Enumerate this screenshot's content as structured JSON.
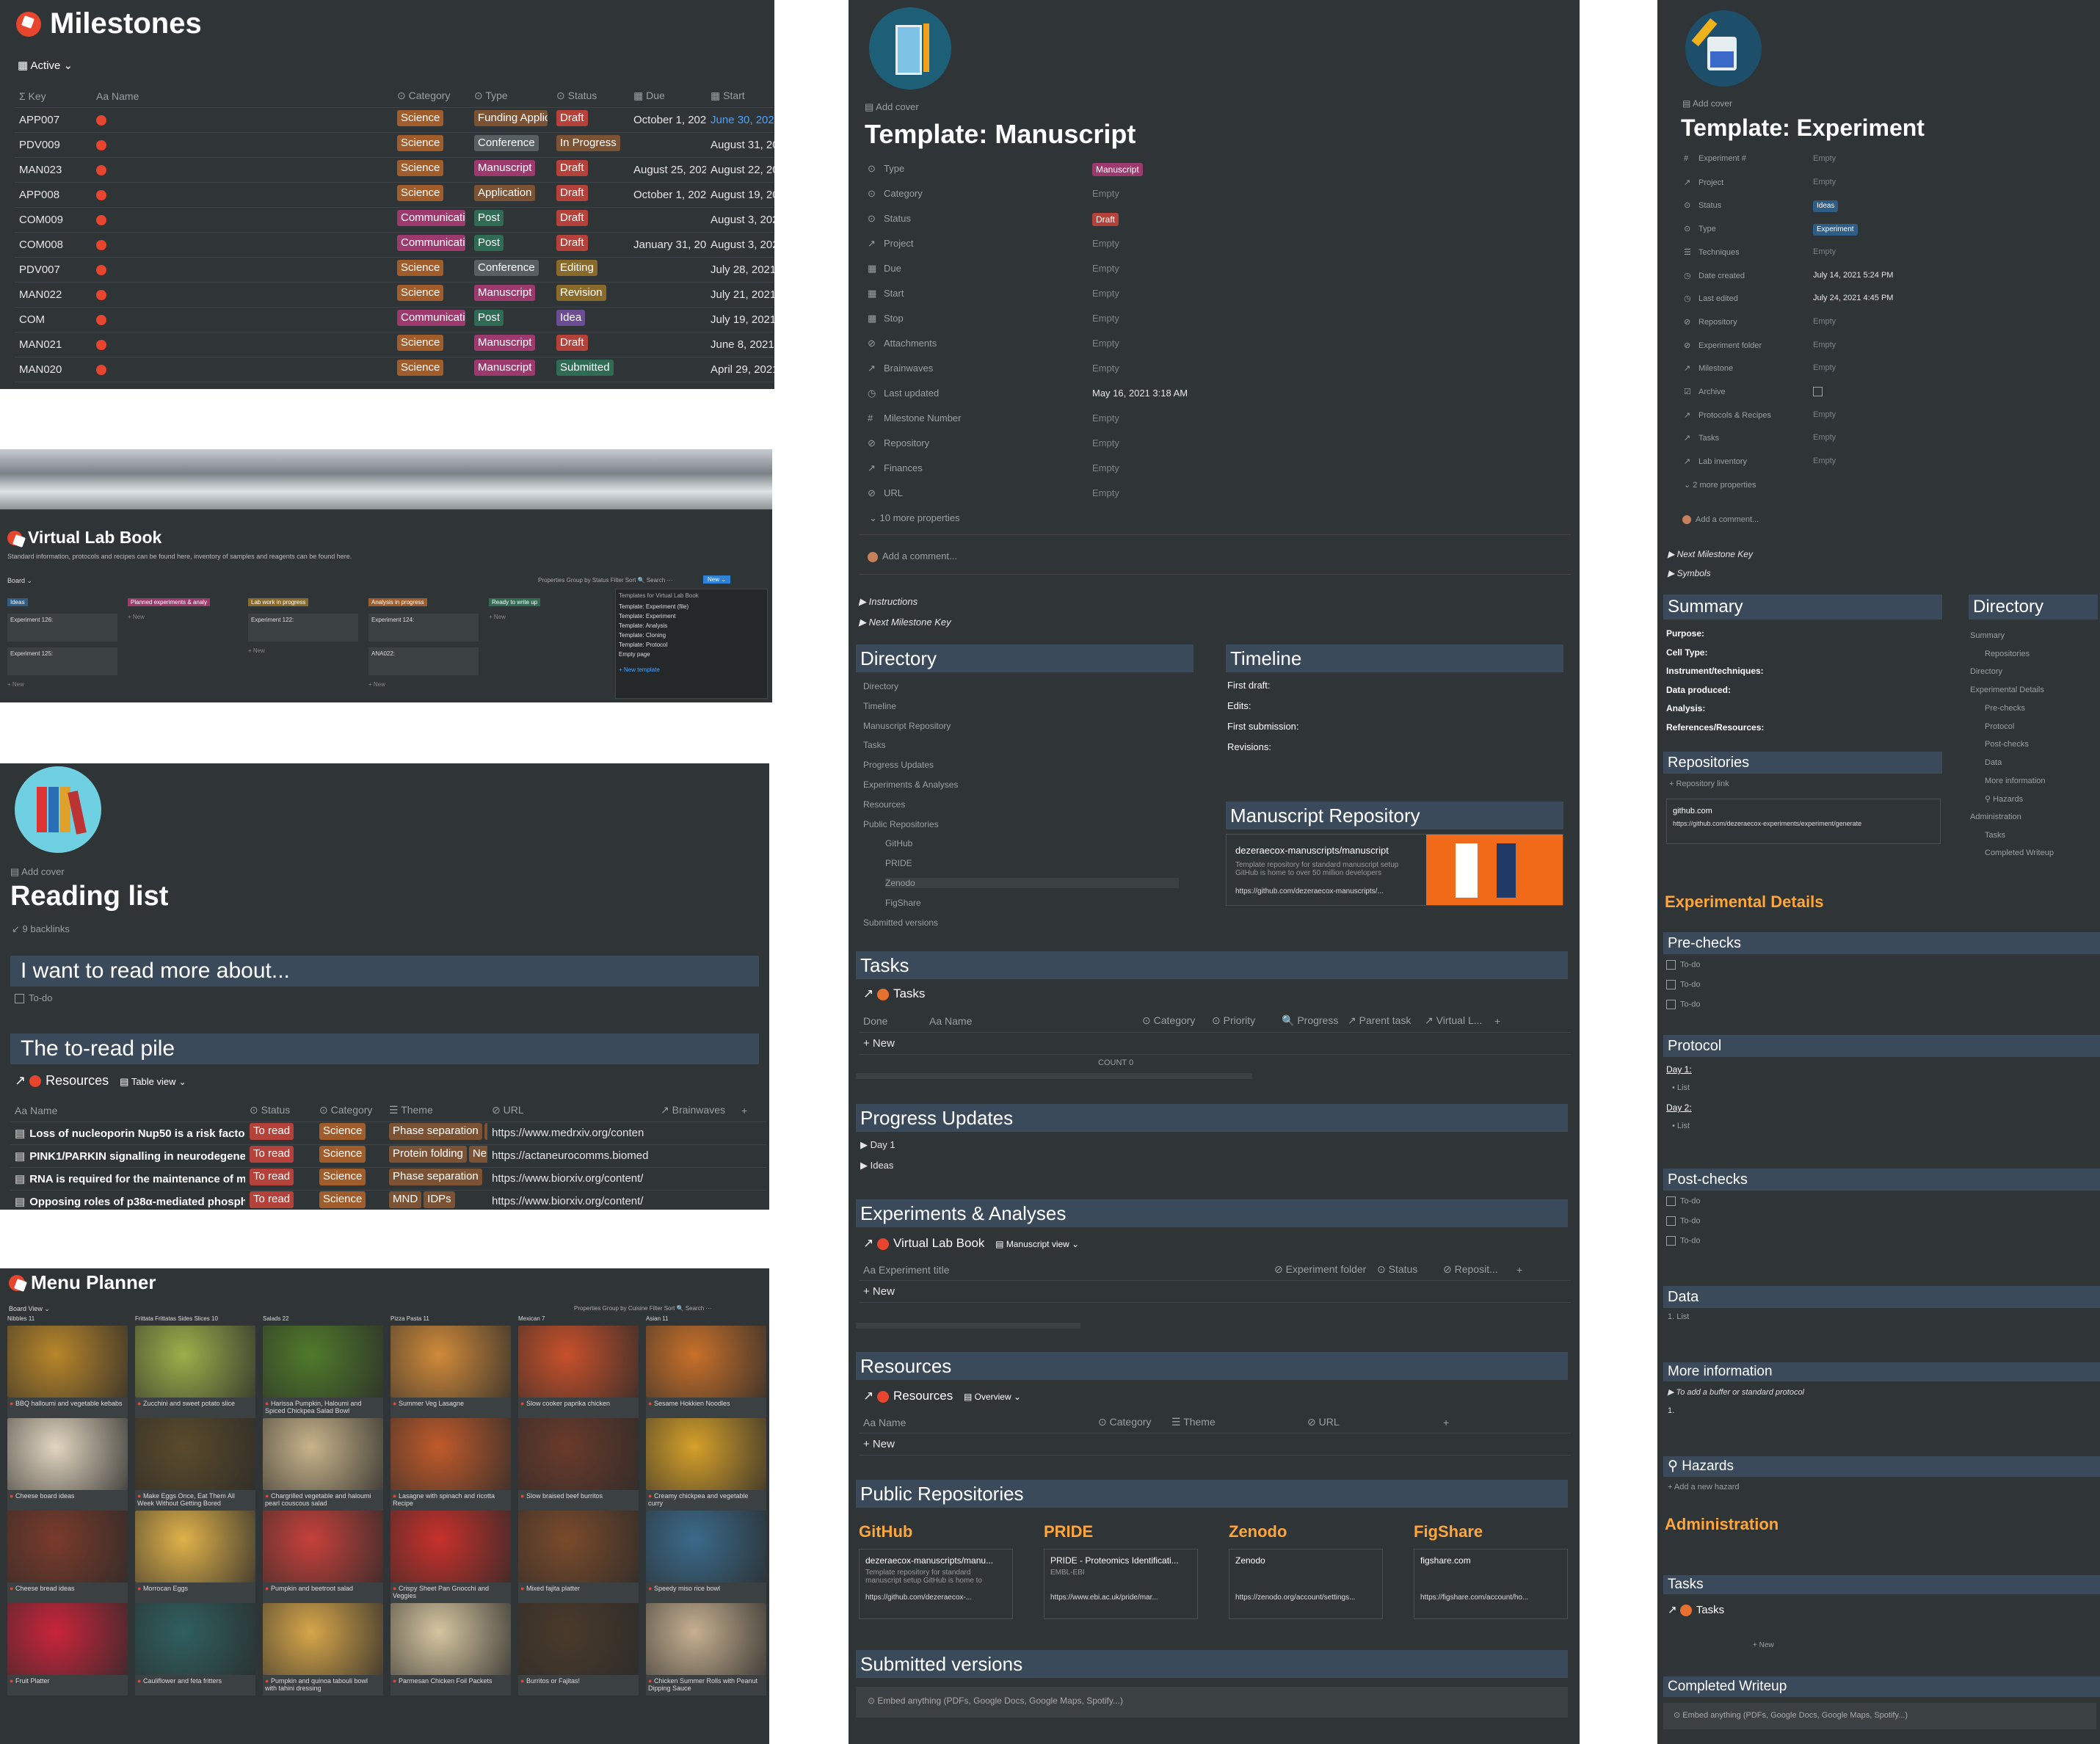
{
  "milestones": {
    "title": "Milestones",
    "view": "Active ⌄",
    "headers": [
      "Σ Key",
      "Aa Name",
      "⊙ Category",
      "⊙ Type",
      "⊙ Status",
      "▦ Due",
      "▦ Start"
    ],
    "rows": [
      {
        "key": "APP007",
        "cat": "Science",
        "type": "Funding Applic",
        "status": "Draft",
        "due": "October 1, 202",
        "start": "June 30, 2022"
      },
      {
        "key": "PDV009",
        "cat": "Science",
        "type": "Conference",
        "status": "In Progress",
        "due": "",
        "start": "August 31, 202"
      },
      {
        "key": "MAN023",
        "cat": "Science",
        "type": "Manuscript",
        "status": "Draft",
        "due": "August 25, 202",
        "start": "August 22, 202"
      },
      {
        "key": "APP008",
        "cat": "Science",
        "type": "Application",
        "status": "Draft",
        "due": "October 1, 202",
        "start": "August 19, 202"
      },
      {
        "key": "COM009",
        "cat": "Communicati",
        "type": "Post",
        "status": "Draft",
        "due": "",
        "start": "August 3, 2021"
      },
      {
        "key": "COM008",
        "cat": "Communicati",
        "type": "Post",
        "status": "Draft",
        "due": "January 31, 202",
        "start": "August 3, 2021"
      },
      {
        "key": "PDV007",
        "cat": "Science",
        "type": "Conference",
        "status": "Editing",
        "due": "",
        "start": "July 28, 2021"
      },
      {
        "key": "MAN022",
        "cat": "Science",
        "type": "Manuscript",
        "status": "Revision",
        "due": "",
        "start": "July 21, 2021"
      },
      {
        "key": "COM",
        "cat": "Communicati",
        "type": "Post",
        "status": "Idea",
        "due": "",
        "start": "July 19, 2021"
      },
      {
        "key": "MAN021",
        "cat": "Science",
        "type": "Manuscript",
        "status": "Draft",
        "due": "",
        "start": "June 8, 2021"
      },
      {
        "key": "MAN020",
        "cat": "Science",
        "type": "Manuscript",
        "status": "Submitted",
        "due": "",
        "start": "April 29, 2021"
      }
    ]
  },
  "labbook": {
    "title": "Virtual Lab Book",
    "desc": "Standard information, protocols and recipes can be found here, inventory of samples and reagents can be found here.",
    "view": "Board ⌄",
    "toolbar": "Properties   Group by Status   Filter   Sort   🔍 Search   ···",
    "new_label": "New ⌄",
    "columns": [
      "Ideas",
      "Planned experiments & analy",
      "Lab work in progress",
      "Analysis in progress",
      "Ready to write up"
    ],
    "cards": [
      "Experiment 126:",
      "Experiment 125:",
      "Experiment 122:",
      "Experiment 124:",
      "ANA022:"
    ],
    "new": "+ New",
    "templates_title": "Templates for Virtual Lab Book",
    "templates": [
      "Template: Experiment (file)",
      "Template: Experiment",
      "Template: Analysis",
      "Template: Cloning",
      "Template: Protocol",
      "Empty page",
      "+ New template"
    ]
  },
  "reading": {
    "add_cover": "▤ Add cover",
    "title": "Reading list",
    "backlinks": "↙ 9 backlinks",
    "h1": "I want to read more about...",
    "todo": "To-do",
    "h2": "The to-read pile",
    "db_title": "Resources",
    "db_view": "▤ Table view ⌄",
    "headers": [
      "Aa Name",
      "⊙ Status",
      "⊙ Category",
      "☰ Theme",
      "⊘ URL",
      "↗ Brainwaves",
      "+"
    ],
    "rows": [
      {
        "name": "Loss of nucleoporin Nup50 is a risk factor for a",
        "status": "To read",
        "cat": "Science",
        "theme": "Phase separation",
        "theme2": "M",
        "url": "https://www.medrxiv.org/conten"
      },
      {
        "name": "PINK1/PARKIN signalling in neurodegeneration",
        "status": "To read",
        "cat": "Science",
        "theme": "Protein folding",
        "theme2": "Neu",
        "url": "https://actaneurocomms.biomed"
      },
      {
        "name": "RNA is required for the maintenance of multipl",
        "status": "To read",
        "cat": "Science",
        "theme": "Phase separation",
        "theme2": "",
        "url": "https://www.biorxiv.org/content/"
      },
      {
        "name": "Opposing roles of p38α-mediated phosphoryla",
        "status": "To read",
        "cat": "Science",
        "theme": "MND",
        "theme2": "IDPs",
        "url": "https://www.biorxiv.org/content/"
      }
    ]
  },
  "menu": {
    "title": "Menu Planner",
    "view": "Board View ⌄",
    "toolbar": "Properties   Group by Cuisine   Filter   Sort   🔍 Search   ···",
    "columns": [
      "Nibbles 11",
      "Frittata Frittatas Sides Slices 10",
      "Salads 22",
      "Pizza Pasta 11",
      "Mexican 7",
      "Asian 11"
    ],
    "recipes": [
      [
        "BBQ halloumi and vegetable kebabs",
        "Cheese board ideas",
        "Cheese bread ideas",
        "Fruit Platter"
      ],
      [
        "Zucchini and sweet potato slice",
        "Make Eggs Once, Eat Them All Week Without Getting Bored",
        "Morrocan Eggs",
        "Cauliflower and feta fritters"
      ],
      [
        "Harissa Pumpkin, Haloumi and Spiced Chickpea Salad Bowl",
        "Chargrilled vegetable and haloumi pearl couscous salad",
        "Pumpkin and beetroot salad",
        "Pumpkin and quinoa tabouli bowl with tahini dressing"
      ],
      [
        "Summer Veg Lasagne",
        "Lasagne with spinach and ricotta Recipe",
        "Crispy Sheet Pan Gnocchi and Veggies",
        "Parmesan Chicken Foil Packets"
      ],
      [
        "Slow cooker paprika chicken",
        "Slow braised beef burritos",
        "Mixed fajita platter",
        "Burritos or Fajitas!"
      ],
      [
        "Sesame Hokkien Noodles",
        "Creamy chickpea and vegetable curry",
        "Speedy miso rice bowl",
        "Chicken Summer Rolls with Peanut Dipping Sauce"
      ]
    ]
  },
  "manuscript": {
    "add_cover": "▤ Add cover",
    "title": "Template: Manuscript",
    "props": [
      {
        "k": "Type",
        "v": "Manuscript"
      },
      {
        "k": "Category",
        "v": "Empty"
      },
      {
        "k": "Status",
        "v": "Draft"
      },
      {
        "k": "Project",
        "v": "Empty"
      },
      {
        "k": "Due",
        "v": "Empty"
      },
      {
        "k": "Start",
        "v": "Empty"
      },
      {
        "k": "Stop",
        "v": "Empty"
      },
      {
        "k": "Attachments",
        "v": "Empty"
      },
      {
        "k": "Brainwaves",
        "v": "Empty"
      },
      {
        "k": "Last updated",
        "v": "May 16, 2021 3:18 AM"
      },
      {
        "k": "Milestone Number",
        "v": "Empty"
      },
      {
        "k": "Repository",
        "v": "Empty"
      },
      {
        "k": "Finances",
        "v": "Empty"
      },
      {
        "k": "URL",
        "v": "Empty"
      }
    ],
    "more_props": "⌄ 10 more properties",
    "comment": "Add a comment...",
    "toggles": [
      "Instructions",
      "Next Milestone Key"
    ],
    "directory_title": "Directory",
    "directory": [
      "Directory",
      "Timeline",
      "Manuscript Repository",
      "Tasks",
      "Progress Updates",
      "Experiments & Analyses",
      "Resources",
      "Public Repositories",
      "GitHub",
      "PRIDE",
      "Zenodo",
      "FigShare",
      "Submitted versions"
    ],
    "timeline_title": "Timeline",
    "timeline": [
      "First draft:",
      "Edits:",
      "First submission:",
      "Revisions:"
    ],
    "repo_title": "Manuscript Repository",
    "repo_name": "dezeraecox-manuscripts/manuscript",
    "repo_desc": "Template repository for standard manuscript setup GitHub is home to over 50 million developers",
    "repo_url": "https://github.com/dezeraecox-manuscripts/...",
    "tasks_title": "Tasks",
    "tasks_db": "Tasks",
    "tasks_headers": [
      "Done",
      "Aa Name",
      "⊙ Category",
      "⊙ Priority",
      "🔍 Progress",
      "↗ Parent task",
      "↗ Virtual L...",
      "+"
    ],
    "new": "+ New",
    "count": "COUNT 0",
    "progress_title": "Progress Updates",
    "progress_items": [
      "Day 1",
      "Ideas"
    ],
    "exp_title": "Experiments & Analyses",
    "exp_db": "Virtual Lab Book",
    "exp_view": "▤ Manuscript view ⌄",
    "exp_headers": [
      "Aa Experiment title",
      "⊘ Experiment folder",
      "⊙ Status",
      "⊘ Reposit...",
      "+"
    ],
    "res_title": "Resources",
    "res_db": "Resources",
    "res_view": "▤ Overview ⌄",
    "res_headers": [
      "Aa Name",
      "⊙ Category",
      "☰ Theme",
      "⊘ URL",
      "+"
    ],
    "pub_title": "Public Repositories",
    "pub": [
      {
        "h": "GitHub",
        "n": "dezeraecox-manuscripts/manu...",
        "d": "Template repository for standard manuscript setup GitHub is home to",
        "u": "https://github.com/dezeraecox-..."
      },
      {
        "h": "PRIDE",
        "n": "PRIDE - Proteomics Identificati...",
        "d": "EMBL-EBI",
        "u": "https://www.ebi.ac.uk/pride/mar..."
      },
      {
        "h": "Zenodo",
        "n": "Zenodo",
        "d": "",
        "u": "https://zenodo.org/account/settings..."
      },
      {
        "h": "FigShare",
        "n": "figshare.com",
        "d": "",
        "u": "https://figshare.com/account/ho..."
      }
    ],
    "sub_title": "Submitted versions",
    "embed": "Embed anything (PDFs, Google Docs, Google Maps, Spotify...)"
  },
  "experiment": {
    "add_cover": "▤ Add cover",
    "title": "Template: Experiment",
    "props": [
      {
        "k": "Experiment #",
        "v": "Empty"
      },
      {
        "k": "Project",
        "v": "Empty"
      },
      {
        "k": "Status",
        "v": "Ideas"
      },
      {
        "k": "Type",
        "v": "Experiment"
      },
      {
        "k": "Techniques",
        "v": "Empty"
      },
      {
        "k": "Date created",
        "v": "July 14, 2021 5:24 PM"
      },
      {
        "k": "Last edited",
        "v": "July 24, 2021 4:45 PM"
      },
      {
        "k": "Repository",
        "v": "Empty"
      },
      {
        "k": "Experiment folder",
        "v": "Empty"
      },
      {
        "k": "Milestone",
        "v": "Empty"
      },
      {
        "k": "Archive",
        "v": ""
      },
      {
        "k": "Protocols & Recipes",
        "v": "Empty"
      },
      {
        "k": "Tasks",
        "v": "Empty"
      },
      {
        "k": "Lab inventory",
        "v": "Empty"
      }
    ],
    "more_props": "⌄ 2 more properties",
    "comment": "Add a comment...",
    "toggles": [
      "Next Milestone Key",
      "Symbols"
    ],
    "summary_title": "Summary",
    "summary": [
      "Purpose:",
      "Cell Type:",
      "Instrument/techniques:",
      "Data produced:",
      "Analysis:",
      "References/Resources:"
    ],
    "dir_title": "Directory",
    "dir": [
      "Summary",
      "Repositories",
      "Directory",
      "Experimental Details",
      "Pre-checks",
      "Protocol",
      "Post-checks",
      "Data",
      "More information",
      "⚲ Hazards",
      "Administration",
      "Tasks",
      "Completed Writeup"
    ],
    "repos_title": "Repositories",
    "repo_link": "+ Repository link",
    "repo_name": "github.com",
    "repo_url": "https://github.com/dezeraecox-experiments/experiment/generate",
    "details_title": "Experimental Details",
    "prechecks": "Pre-checks",
    "todo": "To-do",
    "protocol": "Protocol",
    "day1": "Day 1:",
    "day2": "Day 2:",
    "list": "List",
    "postchecks": "Post-checks",
    "data": "Data",
    "more_info": "More information",
    "more_toggle": "To add a buffer or standard protocol",
    "hazards": "Hazards",
    "add_hazard": "+ Add a new hazard",
    "admin": "Administration",
    "tasks": "Tasks",
    "tasks_db": "Tasks",
    "new": "+ New",
    "writeup": "Completed Writeup",
    "embed": "Embed anything (PDFs, Google Docs, Google Maps, Spotify...)"
  }
}
